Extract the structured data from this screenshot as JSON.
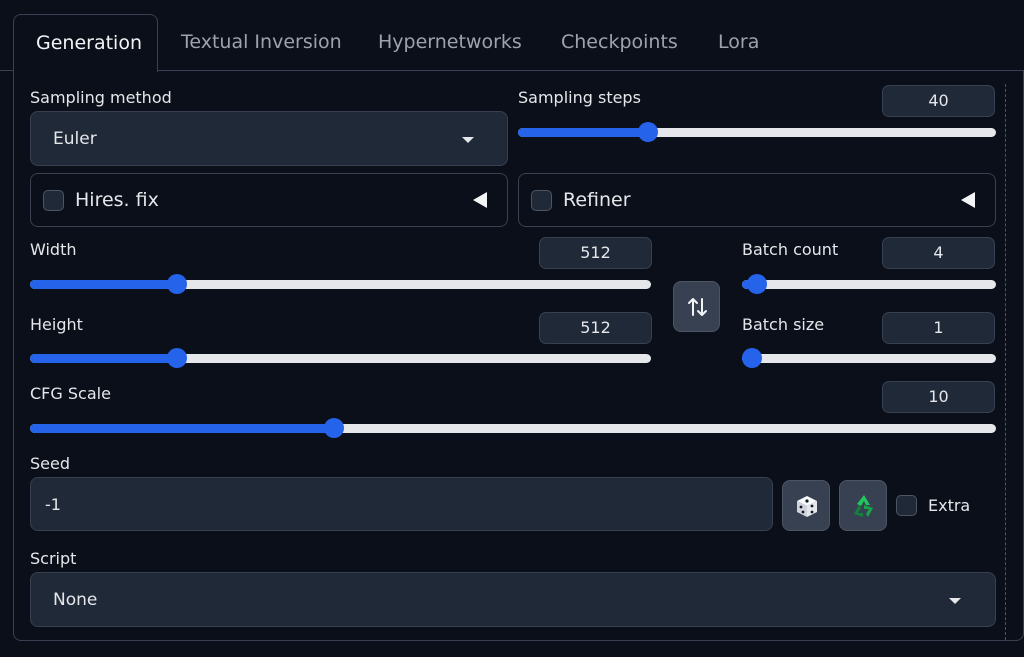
{
  "tabs": [
    "Generation",
    "Textual Inversion",
    "Hypernetworks",
    "Checkpoints",
    "Lora"
  ],
  "sampling_method": {
    "label": "Sampling method",
    "value": "Euler"
  },
  "sampling_steps": {
    "label": "Sampling steps",
    "value": "40",
    "fraction": 0.272
  },
  "hires_fix": {
    "label": "Hires. fix",
    "checked": false
  },
  "refiner": {
    "label": "Refiner",
    "checked": false
  },
  "width": {
    "label": "Width",
    "value": "512",
    "fraction": 0.236
  },
  "height": {
    "label": "Height",
    "value": "512",
    "fraction": 0.236
  },
  "swap_icon": "swap-vertical-icon",
  "batch_count": {
    "label": "Batch count",
    "value": "4",
    "fraction": 0.061
  },
  "batch_size": {
    "label": "Batch size",
    "value": "1",
    "fraction": 0.0
  },
  "cfg_scale": {
    "label": "CFG Scale",
    "value": "10",
    "fraction": 0.315
  },
  "seed": {
    "label": "Seed",
    "value": "-1",
    "dice_icon": "dice-icon",
    "recycle_icon": "recycle-icon"
  },
  "extra": {
    "label": "Extra",
    "checked": false
  },
  "script": {
    "label": "Script",
    "value": "None"
  },
  "colors": {
    "accent": "#2563eb",
    "background": "#0b0f19",
    "input": "#1f2937",
    "border": "#374151"
  }
}
